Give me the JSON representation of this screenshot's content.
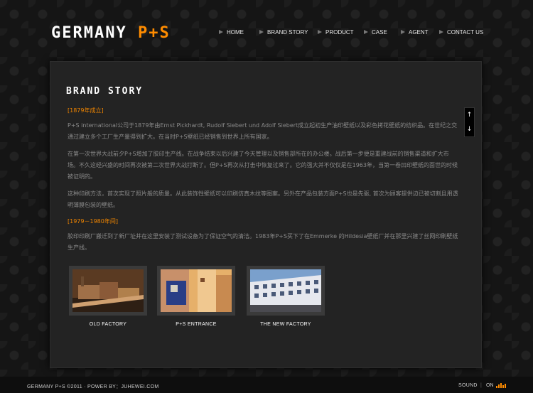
{
  "header": {
    "logo_main": "GERMANY",
    "logo_brand": "P+S",
    "nav": [
      {
        "label": "HOME"
      },
      {
        "label": "BRAND STORY"
      },
      {
        "label": "PRODUCT"
      },
      {
        "label": "CASE"
      },
      {
        "label": "AGENT"
      },
      {
        "label": "CONTACT US"
      }
    ]
  },
  "main": {
    "title": "BRAND STORY",
    "sections": [
      {
        "heading": "[1879年成立]",
        "paragraphs": [
          "P+S international公司于1879年由Ernst Pickhardt, Rudolf Siebert und Adolf Siebert成立起初生产油印壁纸以及彩色拷花壁纸的纺织品。在世纪之交通过建立多个工厂生产量得到扩大。在当时P+S壁纸已经销售到世界上所有国家。",
          "在第一次世界大战前夕P+S增加了胶印生产线。在战争结束以后兴建了今天管理以及销售部所在的办公楼。战后第一步便是重建战前的销售渠道和扩大市场。不久这经兴盛的时间再次被第二次世界大战打断了。但P+S再次从打击中恢复过来了。它的强大并不仅仅是在1963年，当第一卷凹印壁纸的面世的时候被证明的。",
          "这种印刷方法，首次实现了照片般的质量。从此装饰性壁纸可以印刷仿真木纹等图案。另外在产品包装方面P+S也是先驱, 首次为顾客提供边已被切割且用透明薄膜包装的壁纸。"
        ]
      },
      {
        "heading": "[1979－1980年间]",
        "paragraphs": [
          "胶印印刷厂搬迁到了新厂址并在这里安装了测试设备为了保证空气的清洁。1983年P+S买下了在Emmerke 的Hildesia壁纸厂并在那里兴建了丝网印刷壁纸生产线。"
        ]
      }
    ],
    "scroll": {
      "up": "↑",
      "down": "↓"
    },
    "gallery": [
      {
        "caption": "OLD FACTORY"
      },
      {
        "caption": "P+S ENTRANCE"
      },
      {
        "caption": "THE NEW FACTORY"
      }
    ]
  },
  "footer": {
    "copyright": "GERMANY P+S ©2011 · POWER BY：JUHEWEI.COM",
    "sound_label": "SOUND",
    "separator": "|",
    "sound_state": "ON"
  },
  "colors": {
    "accent": "#ff8c00",
    "heading": "#ee8400",
    "background": "#151515",
    "panel": "#232323"
  }
}
